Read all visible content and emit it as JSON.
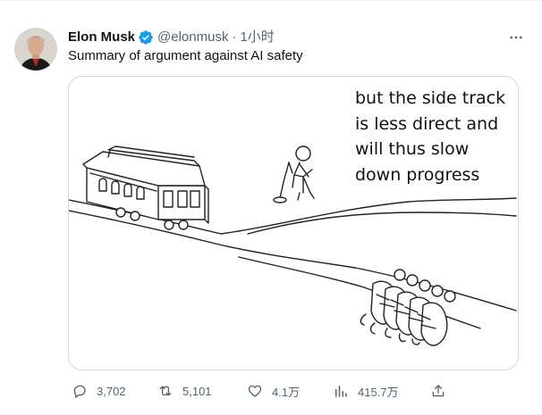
{
  "author": {
    "name": "Elon Musk",
    "handle": "@elonmusk",
    "separator": "·",
    "time": "1小时"
  },
  "tweet": {
    "text": "Summary of argument against AI safety"
  },
  "meme": {
    "caption": "but the side track\nis less direct and\nwill thus slow\ndown progress"
  },
  "stats": {
    "replies": "3,702",
    "retweets": "5,101",
    "likes": "4.1万",
    "views": "415.7万"
  },
  "icons": {
    "verified": "verified-badge-icon",
    "more": "more-dots-icon",
    "reply": "reply-icon",
    "retweet": "retweet-icon",
    "like": "heart-icon",
    "views": "views-chart-icon",
    "share": "share-icon"
  },
  "colors": {
    "verified": "#1d9bf0",
    "secondary_text": "#536471",
    "border": "#cfd9de"
  }
}
